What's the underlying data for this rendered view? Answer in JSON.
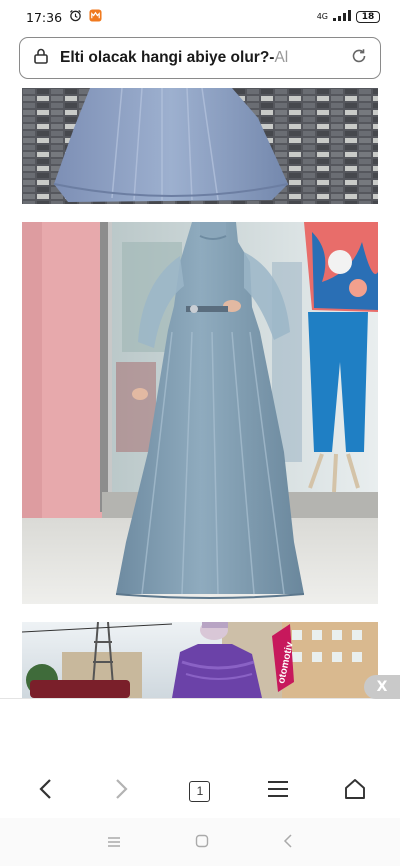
{
  "status_bar": {
    "time": "17:36",
    "network": "4G",
    "battery": "18"
  },
  "address_bar": {
    "title": "Elti olacak hangi abiye olur?-",
    "host_fragment": "Al"
  },
  "ad": {
    "close_label": "X"
  },
  "toolbar": {
    "tab_count": "1"
  },
  "photos": [
    {
      "name": "blue-gown-photo-top"
    },
    {
      "name": "tulle-gown-photo-middle"
    },
    {
      "name": "purple-dress-photo-bottom",
      "sign_text": "otomotiv"
    }
  ],
  "colors": {
    "accent": "#4a86a8",
    "dress_blue": "#7f9fb5",
    "wall_pink": "#e7a9ac"
  }
}
